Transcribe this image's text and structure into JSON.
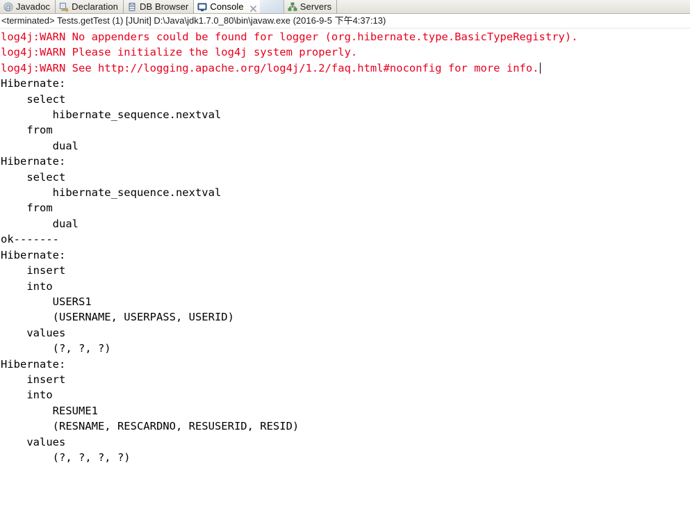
{
  "window": {
    "view_name": "Console"
  },
  "tabs": [
    {
      "id": "javadoc",
      "label": "Javadoc",
      "icon": "at-sign-icon",
      "active": false
    },
    {
      "id": "declaration",
      "label": "Declaration",
      "icon": "declaration-icon",
      "active": false
    },
    {
      "id": "db-browser",
      "label": "DB Browser",
      "icon": "database-icon",
      "active": false
    },
    {
      "id": "console",
      "label": "Console",
      "icon": "console-icon",
      "active": true,
      "close_icon": "close-icon"
    },
    {
      "id": "servers",
      "label": "Servers",
      "icon": "servers-icon",
      "active": false
    }
  ],
  "status": {
    "text": "<terminated> Tests.getTest (1) [JUnit] D:\\Java\\jdk1.7.0_80\\bin\\javaw.exe (2016-9-5 下午4:37:13)"
  },
  "console": {
    "warn_color": "#e8001e",
    "out_color": "#000000",
    "warnings": [
      "log4j:WARN No appenders could be found for logger (org.hibernate.type.BasicTypeRegistry).",
      "log4j:WARN Please initialize the log4j system properly.",
      "log4j:WARN See http://logging.apache.org/log4j/1.2/faq.html#noconfig for more info."
    ],
    "output": "Hibernate: \n    select\n        hibernate_sequence.nextval \n    from\n        dual\nHibernate: \n    select\n        hibernate_sequence.nextval \n    from\n        dual\nok-------\nHibernate: \n    insert \n    into\n        USERS1\n        (USERNAME, USERPASS, USERID) \n    values\n        (?, ?, ?)\nHibernate: \n    insert \n    into\n        RESUME1\n        (RESNAME, RESCARDNO, RESUSERID, RESID) \n    values\n        (?, ?, ?, ?)"
  }
}
